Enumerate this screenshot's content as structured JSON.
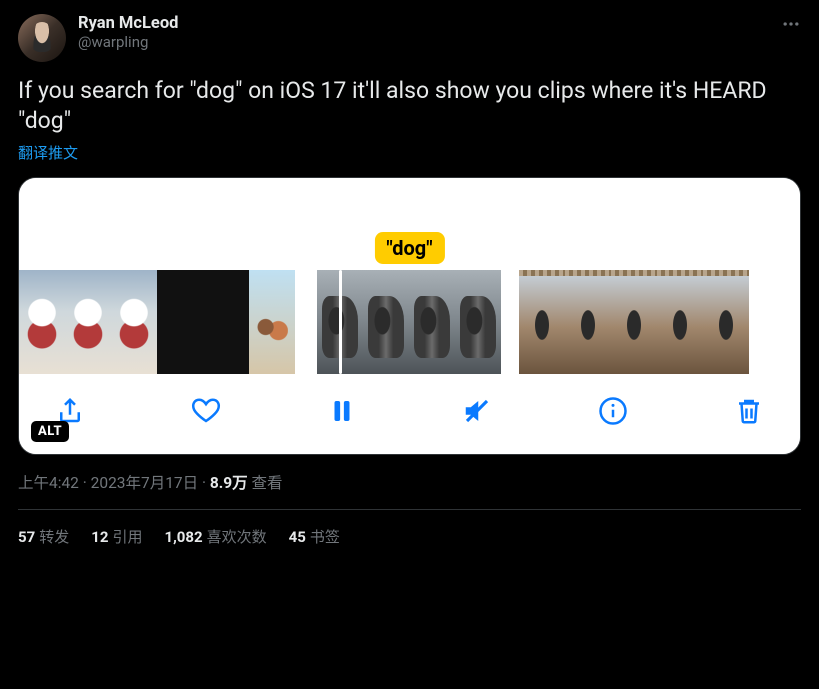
{
  "author": {
    "display_name": "Ryan McLeod",
    "handle": "@warpling"
  },
  "tweet_text": "If you search for \"dog\" on iOS 17 it'll also show you clips where it's HEARD \"dog\"",
  "translate_label": "翻译推文",
  "media": {
    "caption_chip": "\"dog\"",
    "alt_badge": "ALT"
  },
  "meta": {
    "time": "上午4:42",
    "date": "2023年7月17日",
    "separator": " · ",
    "views_count": "8.9万",
    "views_label": " 查看"
  },
  "stats": {
    "retweets_count": "57",
    "retweets_label": "转发",
    "quotes_count": "12",
    "quotes_label": "引用",
    "likes_count": "1,082",
    "likes_label": "喜欢次数",
    "bookmarks_count": "45",
    "bookmarks_label": "书签"
  }
}
